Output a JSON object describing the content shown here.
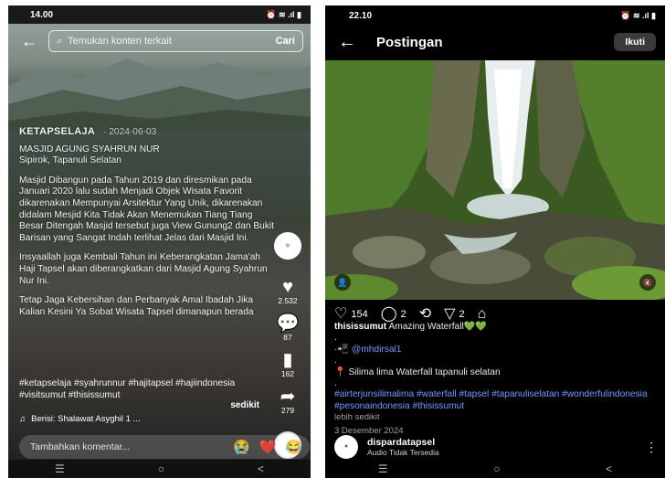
{
  "left": {
    "status": {
      "time": "14.00",
      "icons": "⏰ ≋ .ıl ▮"
    },
    "search": {
      "placeholder": "Temukan konten terkait",
      "button": "Cari"
    },
    "post": {
      "author": "KETAPSELAJA",
      "date": "· 2024-06-03",
      "location_title": "MASJID AGUNG SYAHRUN NUR",
      "location_sub": "Sipirok, Tapanuli Selatan",
      "paragraph1": "Masjid Dibangun pada Tahun 2019 dan diresmikan pada Januari 2020 lalu sudah Menjadi Objek Wisata Favorit dikarenakan Mempunyai Arsitektur Yang Unik, dikarenakan didalam Mesjid Kita Tidak Akan Menemukan Tiang Tiang Besar Ditengah Masjid tersebut juga View Gunung2 dan Bukit Barisan yang  Sangat Indah terlihat Jelas dari Masjid Ini.",
      "paragraph2": "Insyaallah juga Kembali Tahun ini Keberangkatan Jama'ah Haji Tapsel akan diberangkatkan dari Masjid Agung Syahrun Nur Ini.",
      "paragraph3": "Tetap Jaga Kebersihan dan Perbanyak Amal Ibadah Jika Kalian Kesini Ya Sobat Wisata Tapsel dimanapun berada",
      "hashtags": "#ketapselaja #syahrunnur #hajitapsel #hajiindonesia  #visitsumut #thisissumut",
      "more": "sedikit",
      "music": "Berisi: Shalawat Asyghil 1 ..."
    },
    "rail": {
      "likes": "2.532",
      "comments": "87",
      "saves": "162",
      "shares": "279"
    },
    "comment": {
      "placeholder": "Tambahkan komentar...",
      "emojis": [
        "😭",
        "❤️",
        "😂"
      ]
    },
    "nav": [
      "☰",
      "○",
      "<"
    ]
  },
  "right": {
    "status": {
      "time": "22.10",
      "icons": "⏰ ≋ .ıl ▮"
    },
    "header": {
      "title": "Postingan",
      "follow": "Ikuti"
    },
    "actions": {
      "likes": "154",
      "comments": "2",
      "shares": "2"
    },
    "caption": {
      "username": "thisissumut",
      "text": "Amazing Waterfall💚💚",
      "dot1": ".",
      "mention_prefix": "·📲",
      "mention": "@mhdirsal1",
      "dot2": ".",
      "location": "📍 Silima lima Waterfall tapanuli selatan",
      "dot3": ".",
      "tags": "#airterjunsilimalima #waterfall #tapsel #tapanuliselatan #wonderfulindonesia #pesonaindonesia #thisissumut",
      "more": "lebih sedikit",
      "date": "3 Desember 2024"
    },
    "audio": {
      "name": "dispardatapsel",
      "sub": "Audio Tidak Tersedia"
    },
    "nav": [
      "☰",
      "○",
      "<"
    ]
  }
}
